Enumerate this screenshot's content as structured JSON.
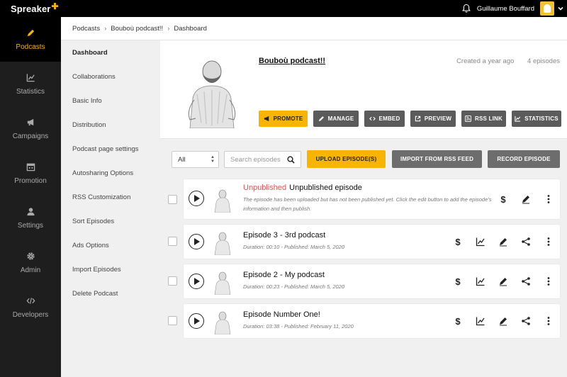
{
  "app": {
    "logo_text": "Spreaker",
    "logo_plus": "✚"
  },
  "topbar": {
    "username": "Guillaume Bouffard"
  },
  "nav": [
    {
      "label": "Podcasts",
      "icon": "pencil-icon",
      "active": true
    },
    {
      "label": "Statistics",
      "icon": "chart-icon",
      "active": false
    },
    {
      "label": "Campaigns",
      "icon": "megaphone-icon",
      "active": false
    },
    {
      "label": "Promotion",
      "icon": "calendar-icon",
      "active": false
    },
    {
      "label": "Settings",
      "icon": "user-icon",
      "active": false
    },
    {
      "label": "Admin",
      "icon": "gear-icon",
      "active": false
    },
    {
      "label": "Developers",
      "icon": "code-icon",
      "active": false
    }
  ],
  "breadcrumb": [
    "Podcasts",
    "Bouboù podcast!!",
    "Dashboard"
  ],
  "subnav": [
    "Dashboard",
    "Collaborations",
    "Basic Info",
    "Distribution",
    "Podcast page settings",
    "Autosharing Options",
    "RSS Customization",
    "Sort Episodes",
    "Ads Options",
    "Import Episodes",
    "Delete Podcast"
  ],
  "podcast": {
    "title": "Bouboù podcast!!",
    "created": "Created a year ago",
    "episodes_count": "4 episodes"
  },
  "actions": {
    "promote": "PROMOTE",
    "manage": "MANAGE",
    "embed": "EMBED",
    "preview": "PREVIEW",
    "rss": "RSS LINK",
    "statistics": "STATISTICS"
  },
  "toolbar": {
    "filter_value": "All",
    "search_placeholder": "Search episodes",
    "upload": "UPLOAD EPISODE(S)",
    "import_rss": "IMPORT FROM RSS FEED",
    "record": "RECORD EPISODE"
  },
  "episodes": [
    {
      "status": "Unpublished",
      "title": "Unpublished episode",
      "subtitle": "The episode has been uploaded but has not been published yet. Click the edit button to add the episode's information and then publish."
    },
    {
      "title": "Episode 3 - 3rd podcast",
      "subtitle": "Duration: 00:10 - Published: March 5, 2020"
    },
    {
      "title": "Episode 2 - My podcast",
      "subtitle": "Duration: 00:23 - Published: March 5, 2020"
    },
    {
      "title": "Episode Number One!",
      "subtitle": "Duration: 03:38 - Published: February 11, 2020"
    }
  ],
  "episode_icons": {
    "monetize": "$"
  },
  "colors": {
    "accent": "#f7b500",
    "unpublished": "#e25252",
    "dark": "#1e1e1e"
  }
}
